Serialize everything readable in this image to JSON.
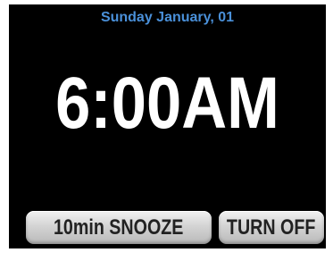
{
  "alarm": {
    "date": "Sunday January, 01",
    "time": "6:00AM"
  },
  "buttons": {
    "snooze_label": "10min SNOOZE",
    "turn_off_label": "TURN OFF"
  },
  "colors": {
    "background": "#000000",
    "date_text": "#4a90d9",
    "time_text": "#ffffff",
    "button_face": "#d4d4d4",
    "button_text": "#222222"
  }
}
